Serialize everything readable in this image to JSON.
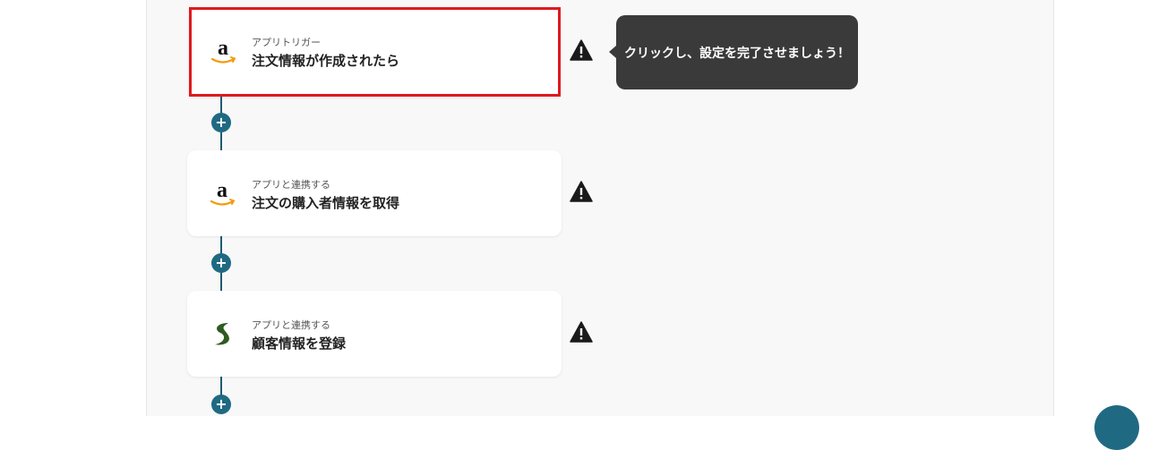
{
  "colors": {
    "accent": "#1f6a82",
    "selected_border": "#e0191e",
    "tooltip_bg": "#3a3a3a",
    "warning": "#1a1a1a"
  },
  "steps": [
    {
      "app_icon": "amazon-icon",
      "subtitle": "アプリトリガー",
      "title": "注文情報が作成されたら",
      "selected": true
    },
    {
      "app_icon": "amazon-icon",
      "subtitle": "アプリと連携する",
      "title": "注文の購入者情報を取得",
      "selected": false
    },
    {
      "app_icon": "sansan-icon",
      "subtitle": "アプリと連携する",
      "title": "顧客情報を登録",
      "selected": false
    }
  ],
  "tooltip": {
    "text": "クリックし、設定を完了させましょう！"
  },
  "add_button_label": "+",
  "warning_icon": "warning-icon"
}
